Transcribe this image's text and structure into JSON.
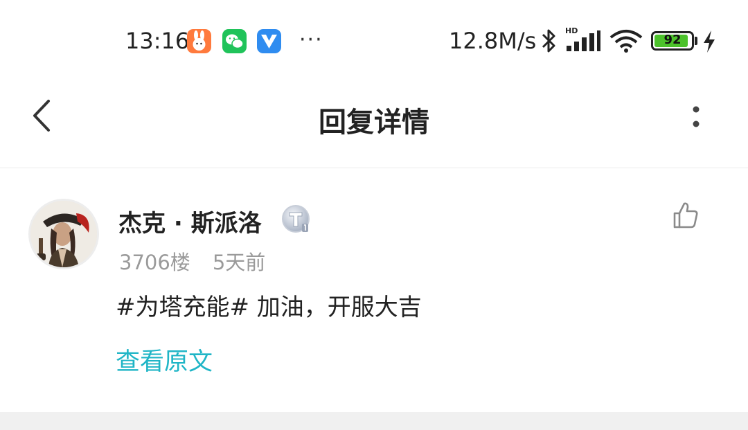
{
  "status_bar": {
    "time": "13:16",
    "apps": [
      "rabbit-app-icon",
      "wechat-icon",
      "game-app-icon"
    ],
    "overflow": "···",
    "net_speed": "12.8M/s",
    "network_type": "HD",
    "battery_percent": "92",
    "battery_level": 0.92,
    "charging": true
  },
  "nav": {
    "title": "回复详情"
  },
  "reply": {
    "username": "杰克 · 斯派洛",
    "floor": "3706楼",
    "time_ago": "5天前",
    "content": "#为塔充能# 加油，开服大吉",
    "view_original": "查看原文",
    "accent_color": "#1fb5c6"
  }
}
